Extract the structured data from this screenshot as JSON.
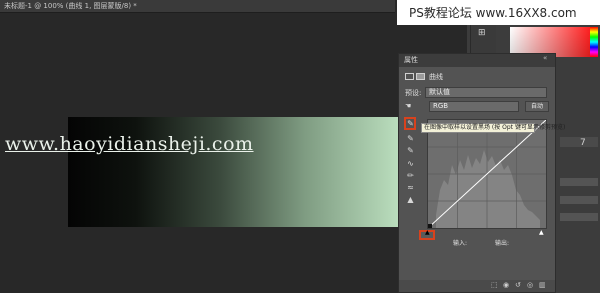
{
  "document": {
    "tab_label": "未标题-1 @ 100% (曲线 1, 图层蒙版/8) *",
    "close_glyph": "×"
  },
  "canvas": {
    "watermark_url": "www.haoyidiansheji.com",
    "gradient_colors": [
      "#040404",
      "#bfe3c2"
    ]
  },
  "banner": {
    "text": "PS教程论坛 www.16XX8.com"
  },
  "dock": {
    "visible_number": "7"
  },
  "properties_panel": {
    "title": "属性",
    "collapse_glyph": "«",
    "adjustment_label": "曲线",
    "preset_label": "预设:",
    "preset_value": "默认值",
    "channel_value": "RGB",
    "auto_button": "自动",
    "tooltip": "在图像中取样以设置黑场 (按 Opt 键可显示修剪预览)",
    "input_label": "输入:",
    "output_label": "输出:",
    "curve_color": "#ffffff",
    "highlight_color": "#d8421d",
    "tools": [
      {
        "name": "eyedropper-black-icon",
        "glyph": "✎"
      },
      {
        "name": "eyedropper-gray-icon",
        "glyph": "✎"
      },
      {
        "name": "eyedropper-white-icon",
        "glyph": "✎"
      },
      {
        "name": "curve-point-icon",
        "glyph": "∿"
      },
      {
        "name": "pencil-icon",
        "glyph": "✏"
      },
      {
        "name": "smooth-icon",
        "glyph": "≈"
      },
      {
        "name": "clip-warning-icon",
        "glyph": "▲"
      }
    ],
    "footer_icons": [
      "clip-to-layer-icon",
      "view-previous-icon",
      "reset-icon",
      "visibility-icon",
      "trash-icon"
    ]
  }
}
